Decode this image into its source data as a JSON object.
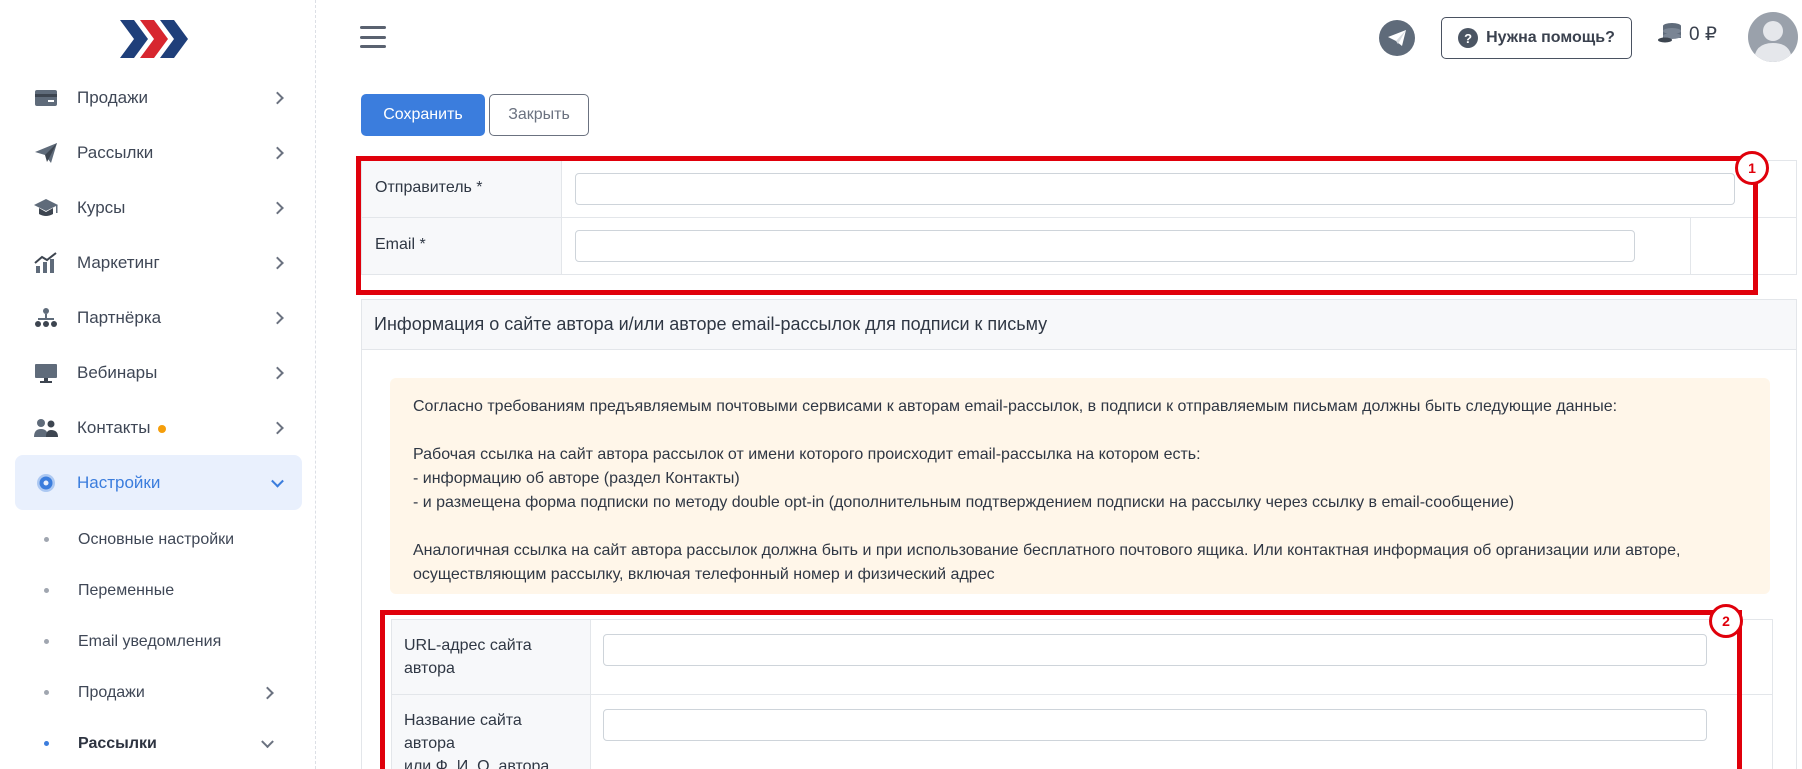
{
  "sidebar": {
    "items": [
      {
        "label": "Продажи",
        "icon": "card-icon"
      },
      {
        "label": "Рассылки",
        "icon": "paper-plane-icon"
      },
      {
        "label": "Курсы",
        "icon": "graduation-cap-icon"
      },
      {
        "label": "Маркетинг",
        "icon": "growth-chart-icon"
      },
      {
        "label": "Партнёрка",
        "icon": "network-icon"
      },
      {
        "label": "Вебинары",
        "icon": "monitor-icon"
      },
      {
        "label": "Контакты",
        "icon": "users-icon"
      },
      {
        "label": "Настройки",
        "icon": "gear-icon"
      }
    ],
    "subitems": [
      {
        "label": "Основные настройки"
      },
      {
        "label": "Переменные"
      },
      {
        "label": "Email уведомления"
      },
      {
        "label": "Продажи"
      },
      {
        "label": "Рассылки"
      }
    ]
  },
  "topbar": {
    "help_label": "Нужна помощь?",
    "help_icon": "?",
    "balance": "0 ₽"
  },
  "toolbar": {
    "save_label": "Сохранить",
    "close_label": "Закрыть"
  },
  "form1": {
    "sender_label": "Отправитель *",
    "sender_value": "",
    "email_label": "Email *",
    "email_value": ""
  },
  "info": {
    "title": "Информация о сайте автора и/или авторе email-рассылок для подписи к письму",
    "notice": {
      "line1": "Согласно требованиям предъявляемым почтовыми сервисами к авторам email-рассылок, в подписи к отправляемым письмам должны быть следующие данные:",
      "line2": "Рабочая ссылка на сайт автора рассылок от имени которого происходит email-рассылка на котором есть:",
      "line3": "- информацию об авторе (раздел Контакты)",
      "line4": "- и размещена форма подписки по методу double opt-in (дополнительным подтверждением подписки на рассылку через ссылку в email-сообщение)",
      "line5": "Аналогичная ссылка на сайт автора рассылок должна быть и при использование бесплатного почтового ящика. Или контактная информация об организации или авторе,",
      "line6": "осуществляющим рассылку, включая телефонный номер и физический адрес"
    }
  },
  "form2": {
    "url_label_1": "URL-адрес сайта",
    "url_label_2": "автора",
    "url_value": "",
    "name_label_1": "Название сайта",
    "name_label_2": "автора",
    "name_label_3": "или Ф. И. О. автора",
    "name_value": ""
  },
  "annotations": {
    "badge1": "1",
    "badge2": "2",
    "color": "#e0000b"
  },
  "colors": {
    "primary": "#3b7ddd",
    "notice_bg": "#fff6e9",
    "accent_dot": "#f59e0b"
  }
}
